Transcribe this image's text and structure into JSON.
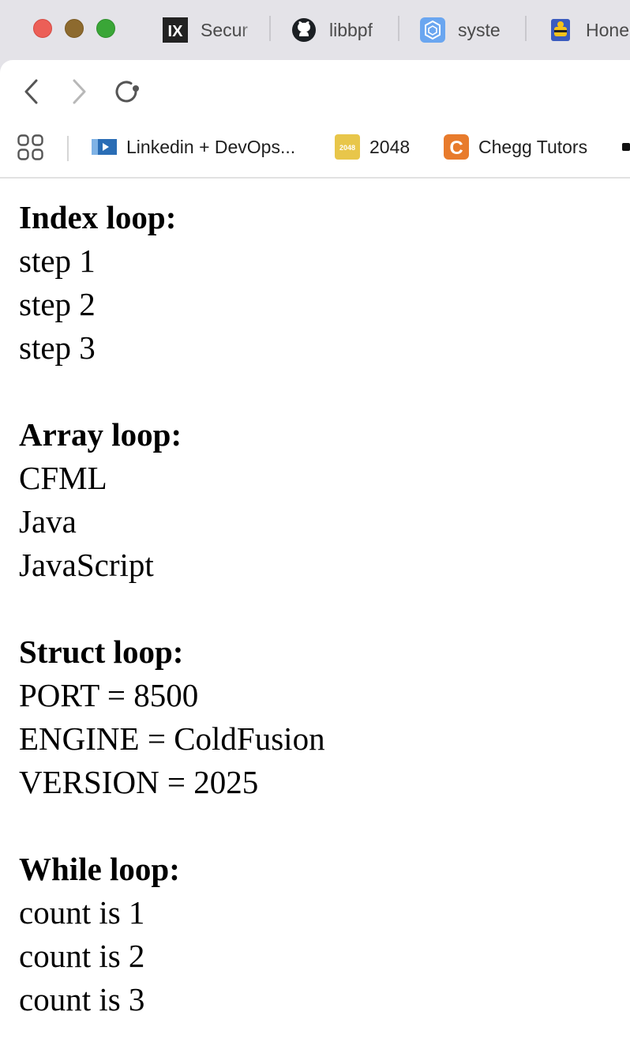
{
  "tabs": [
    {
      "label": "Secur",
      "icon": "ix-logo-icon"
    },
    {
      "label": "libbpf",
      "icon": "github-icon"
    },
    {
      "label": "syste",
      "icon": "hexagon-app-icon"
    },
    {
      "label": "Hone",
      "icon": "honeycomb-bee-icon"
    }
  ],
  "bookmarks": [
    {
      "label": "Linkedin + DevOps...",
      "icon": "video-play-icon"
    },
    {
      "label": "2048",
      "icon": "game-2048-icon",
      "icon_text": "2048"
    },
    {
      "label": "Chegg Tutors",
      "icon": "chegg-icon",
      "icon_text": "C"
    }
  ],
  "sections": [
    {
      "heading": "Index loop:",
      "lines": [
        "step 1",
        "step 2",
        "step 3"
      ]
    },
    {
      "heading": "Array loop:",
      "lines": [
        "CFML",
        "Java",
        "JavaScript"
      ]
    },
    {
      "heading": "Struct loop:",
      "lines": [
        "PORT = 8500",
        "ENGINE = ColdFusion",
        "VERSION = 2025"
      ]
    },
    {
      "heading": "While loop:",
      "lines": [
        "count is 1",
        "count is 2",
        "count is 3"
      ]
    }
  ],
  "colors": {
    "close": "#ec5f57",
    "minimize": "#8d6a2e",
    "maximize": "#3aa637",
    "tabstrip_bg": "#e4e3e8",
    "game_2048": "#e8c64a",
    "chegg": "#e87b2c"
  }
}
